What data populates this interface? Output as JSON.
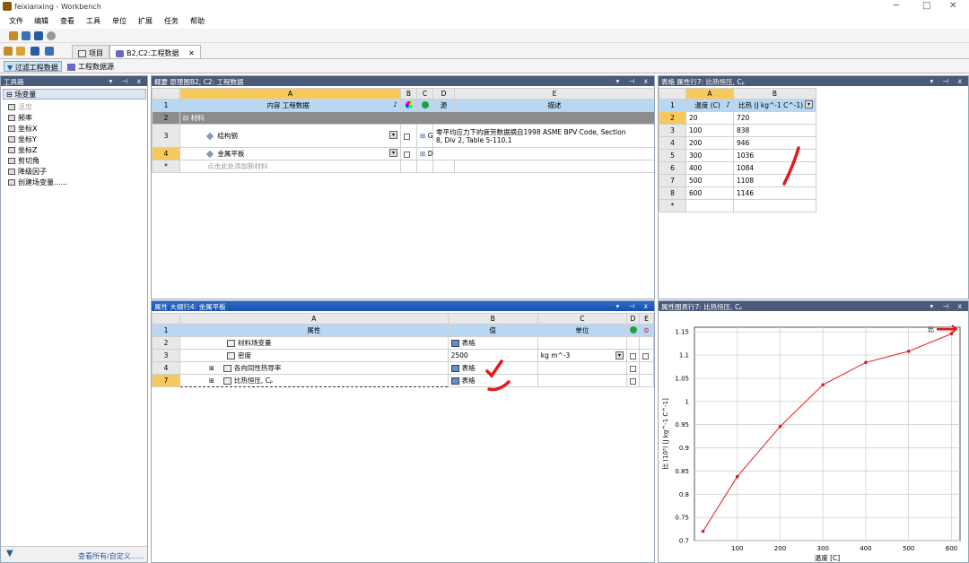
{
  "window": {
    "title": "feixianxing - Workbench"
  },
  "menu": [
    "文件",
    "编辑",
    "查看",
    "工具",
    "单位",
    "扩展",
    "任务",
    "帮助"
  ],
  "tabs": {
    "project": "项目",
    "engdata": "B2,C2:工程数据"
  },
  "subtoolbar": {
    "filter": "过滤工程数据",
    "sources": "工程数据源"
  },
  "toolbox": {
    "title": "工具箱",
    "group": "场变量",
    "items": [
      "温度",
      "频率",
      "坐标X",
      "坐标Y",
      "坐标Z",
      "剪切角",
      "降级因子",
      "创建场变量......"
    ],
    "footer": "查看所有/自定义......"
  },
  "outline": {
    "title": "概要 原理图B2, C2:  工程数据",
    "cols": [
      "A",
      "B",
      "C",
      "D",
      "E"
    ],
    "hdr": {
      "content": "内容 工程数据",
      "source": "源",
      "desc": "描述"
    },
    "group": "材料",
    "rows": [
      {
        "num": "3",
        "name": "结构钢",
        "src": "G",
        "desc1": "零平均应力下的疲劳数据摘自1998 ASME BPV Code, Section",
        "desc2": "8, Div 2, Table 5-110.1"
      },
      {
        "num": "4",
        "name": "金属平板",
        "src": "D",
        "desc1": "",
        "desc2": ""
      }
    ],
    "add": "点击此处添加新材料",
    "rn": [
      "1",
      "2",
      "*"
    ]
  },
  "props": {
    "title": "属性 大纲行4:  金属平板",
    "cols": [
      "A",
      "B",
      "C",
      "D",
      "E"
    ],
    "hdr": {
      "prop": "属性",
      "val": "值",
      "unit": "单位"
    },
    "rows": [
      {
        "num": "2",
        "name": "材料场变量",
        "val": "表格",
        "unit": ""
      },
      {
        "num": "3",
        "name": "密度",
        "val": "2500",
        "unit": "kg m^-3"
      },
      {
        "num": "4",
        "name": "各向同性热导率",
        "val": "表格",
        "unit": ""
      },
      {
        "num": "7",
        "name": "比热恒压, Cₚ",
        "val": "表格",
        "unit": ""
      }
    ]
  },
  "table": {
    "title": "表格 属性行7:  比热恒压, Cₚ",
    "cols": [
      "A",
      "B"
    ],
    "hdr": {
      "a": "温度 (C)",
      "b": "比热 (J kg^-1 C^-1)"
    },
    "rows": [
      [
        "2",
        "20",
        "720"
      ],
      [
        "3",
        "100",
        "838"
      ],
      [
        "4",
        "200",
        "946"
      ],
      [
        "5",
        "300",
        "1036"
      ],
      [
        "6",
        "400",
        "1084"
      ],
      [
        "7",
        "500",
        "1108"
      ],
      [
        "8",
        "600",
        "1146"
      ],
      [
        "*",
        "",
        ""
      ]
    ],
    "rn1": "1"
  },
  "chartpanel": {
    "title": "属性图表行7:  比热恒压, Cₚ"
  },
  "chart_data": {
    "type": "line",
    "x": [
      20,
      100,
      200,
      300,
      400,
      500,
      600
    ],
    "series": [
      {
        "name": "比",
        "values": [
          0.72,
          0.838,
          0.946,
          1.036,
          1.084,
          1.108,
          1.146
        ]
      }
    ],
    "xlabel": "温度 [C]",
    "ylabel": "比 (10³) [J kg^-1 C^-1]",
    "xlim": [
      0,
      620
    ],
    "ylim": [
      0.7,
      1.16
    ],
    "xticks": [
      100,
      200,
      300,
      400,
      500,
      600
    ],
    "yticks": [
      0.7,
      0.75,
      0.8,
      0.85,
      0.9,
      0.95,
      1,
      1.05,
      1.1,
      1.15
    ],
    "grid": true,
    "legend": "top-right",
    "color": "#e31a1c"
  }
}
